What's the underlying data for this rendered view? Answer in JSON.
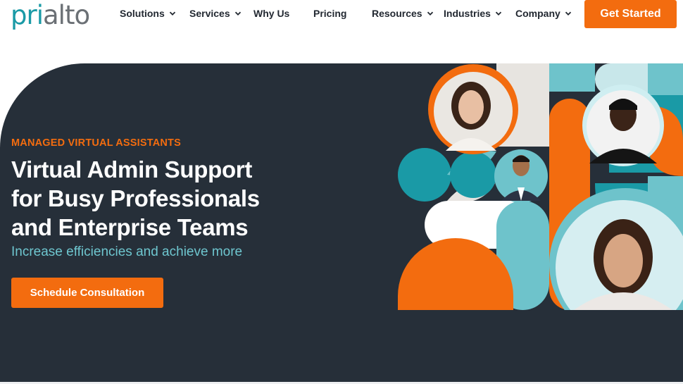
{
  "brand": {
    "logo_part1": "pri",
    "logo_part2": "alto",
    "color_teal": "#1a9aa6",
    "color_grey": "#6b7075",
    "color_orange": "#f36c0f",
    "hero_bg": "#262f39"
  },
  "nav": {
    "items": [
      {
        "label": "Solutions",
        "dropdown": true
      },
      {
        "label": "Services",
        "dropdown": true
      },
      {
        "label": "Why Us",
        "dropdown": false
      },
      {
        "label": "Pricing",
        "dropdown": false
      },
      {
        "label": "Resources",
        "dropdown": true
      },
      {
        "label": "Industries",
        "dropdown": true
      },
      {
        "label": "Company",
        "dropdown": true
      }
    ],
    "cta_label": "Get Started",
    "chevron_icon": "chevron-down-icon"
  },
  "hero": {
    "eyebrow": "MANAGED VIRTUAL ASSISTANTS",
    "headline_line1": "Virtual Admin Support",
    "headline_line2": "for Busy Professionals",
    "headline_line3": "and Enterprise Teams",
    "subhead": "Increase efficiencies and achieve more",
    "cta_label": "Schedule Consultation"
  }
}
